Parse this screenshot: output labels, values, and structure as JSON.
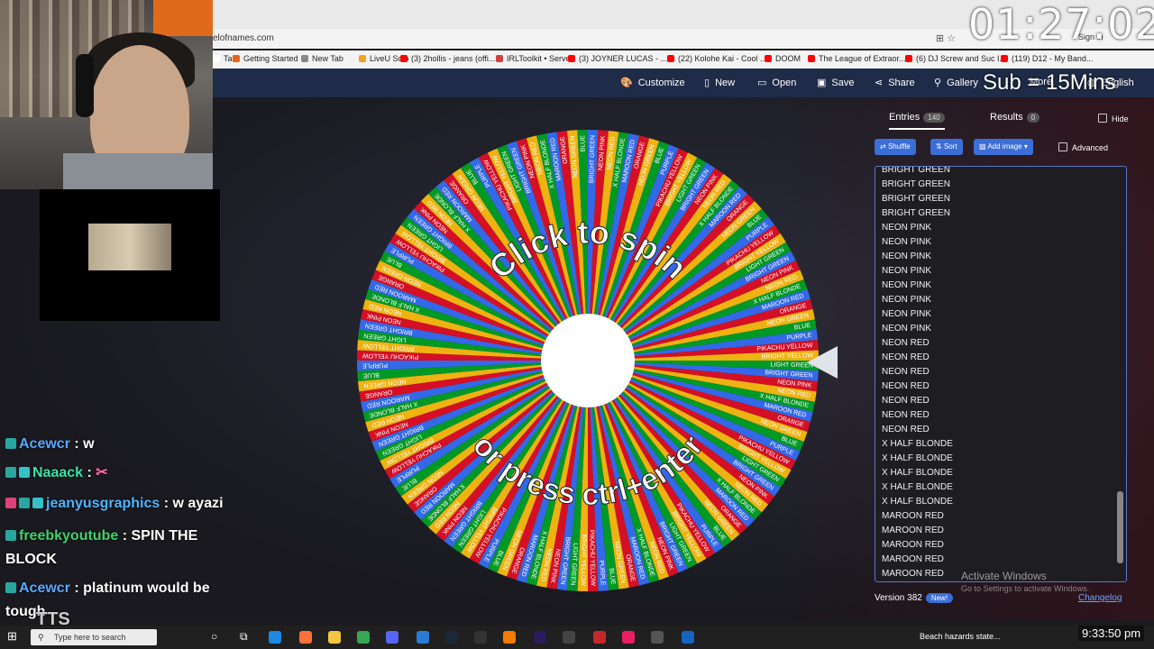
{
  "browser": {
    "url": "elofnames.com",
    "bookmarks": [
      {
        "label": "Tab",
        "color": "#ffffff"
      },
      {
        "label": "Getting Started",
        "color": "#e8641a"
      },
      {
        "label": "New Tab",
        "color": "#888888"
      },
      {
        "label": "LiveU Solo",
        "color": "#f0a020"
      },
      {
        "label": "(3) 2hollis - jeans (offi...",
        "color": "#ff0000"
      },
      {
        "label": "IRLToolkit • Server",
        "color": "#d04040"
      },
      {
        "label": "(3) JOYNER LUCAS - ...",
        "color": "#ff0000"
      },
      {
        "label": "(22) Kolohe Kai - Cool ...",
        "color": "#ff0000"
      },
      {
        "label": "DOOM",
        "color": "#ff0000"
      },
      {
        "label": "The League of Extraor...",
        "color": "#ff0000"
      },
      {
        "label": "(6) DJ Screw and Suc I...",
        "color": "#ff0000"
      },
      {
        "label": "(119) D12 - My Band...",
        "color": "#ff0000"
      }
    ],
    "signin": "Sign in"
  },
  "toolbar": {
    "customize": "Customize",
    "new": "New",
    "open": "Open",
    "save": "Save",
    "share": "Share",
    "gallery": "Gallery",
    "more": "More",
    "language": "English"
  },
  "wheel": {
    "top_text": "Click to spin",
    "bottom_text": "or press ctrl+enter",
    "segment_labels": [
      "BRIGHT GREEN",
      "NEON PINK",
      "NEON RED",
      "X HALF BLONDE",
      "MAROON RED",
      "ORANGE",
      "NEON GREEN",
      "BLUE",
      "PURPLE",
      "PIKACHU YELLOW",
      "BRIGHT YELLOW",
      "LIGHT GREEN"
    ],
    "segment_count": 140,
    "colors": [
      "#3369e8",
      "#d50f25",
      "#eeb211",
      "#009925"
    ]
  },
  "panel": {
    "tab_entries": "Entries",
    "entries_count": "140",
    "tab_results": "Results",
    "results_count": "0",
    "hide": "Hide",
    "shuffle": "Shuffle",
    "sort": "Sort",
    "add_image": "Add image",
    "advanced": "Advanced",
    "entries": [
      "BRIGHT GREEN",
      "BRIGHT GREEN",
      "BRIGHT GREEN",
      "BRIGHT GREEN",
      "NEON PINK",
      "NEON PINK",
      "NEON PINK",
      "NEON PINK",
      "NEON PINK",
      "NEON PINK",
      "NEON PINK",
      "NEON PINK",
      "NEON RED",
      "NEON RED",
      "NEON RED",
      "NEON RED",
      "NEON RED",
      "NEON RED",
      "NEON RED",
      "X HALF BLONDE",
      "X HALF BLONDE",
      "X HALF BLONDE",
      "X HALF BLONDE",
      "X HALF BLONDE",
      "MAROON RED",
      "MAROON RED",
      "MAROON RED",
      "MAROON RED",
      "MAROON RED"
    ],
    "version": "Version 382",
    "new_badge": "New!",
    "changelog": "Changelog"
  },
  "windows_watermark": {
    "line1": "Activate Windows",
    "line2": "Go to Settings to activate Windows."
  },
  "stream": {
    "timer": "01:27:02",
    "subtimer": "Sub = 15Mins",
    "chat": [
      {
        "user": "Acewcr",
        "msg": ": w"
      },
      {
        "user": "Naaack",
        "msg": ":"
      },
      {
        "user": "jeanyusgraphics",
        "msg": ": w ayazi"
      },
      {
        "user": "freebkyoutube",
        "msg": ": SPIN THE BLOCK"
      },
      {
        "user": "Acewcr",
        "msg": ": platinum would be tough"
      }
    ],
    "chat_footer": "TTS"
  },
  "taskbar": {
    "search_placeholder": "Type here to search",
    "weather": "Beach hazards state...",
    "time": "9:33:50 pm"
  }
}
